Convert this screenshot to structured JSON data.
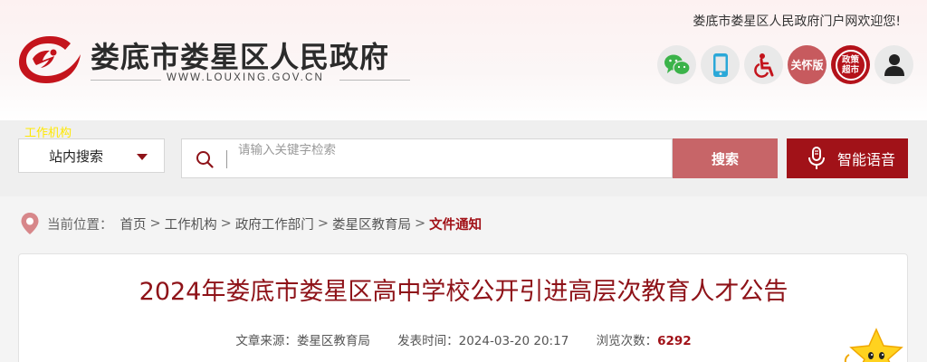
{
  "site": {
    "name": "娄底市娄星区人民政府",
    "domain": "WWW.LOUXING.GOV.CN",
    "welcome": "娄底市娄星区人民政府门户网欢迎您!"
  },
  "header_icons": {
    "wechat": "wechat-icon",
    "mobile": "mobile-icon",
    "accessibility": "wheelchair-icon",
    "care_label": "关怀版",
    "policy_label_1": "政策",
    "policy_label_2": "超市",
    "user": "user-icon"
  },
  "search": {
    "tiny_label": "工作机构",
    "scope_label": "站内搜索",
    "placeholder": "请输入关键字检索",
    "button_label": "搜索",
    "voice_label": "智能语音"
  },
  "breadcrumb": {
    "prefix": "当前位置：",
    "items": [
      "首页",
      "工作机构",
      "政府工作部门",
      "娄星区教育局"
    ],
    "current": "文件通知",
    "separator": ">"
  },
  "article": {
    "title": "2024年娄底市娄星区高中学校公开引进高层次教育人才公告",
    "source_label": "文章来源：",
    "source": "娄星区教育局",
    "time_label": "发表时间：",
    "time": "2024-03-20 20:17",
    "views_label": "浏览次数：",
    "views": "6292"
  },
  "colors": {
    "brand_red": "#a11218",
    "title_red": "#8e1218",
    "search_button": "#c76568"
  }
}
